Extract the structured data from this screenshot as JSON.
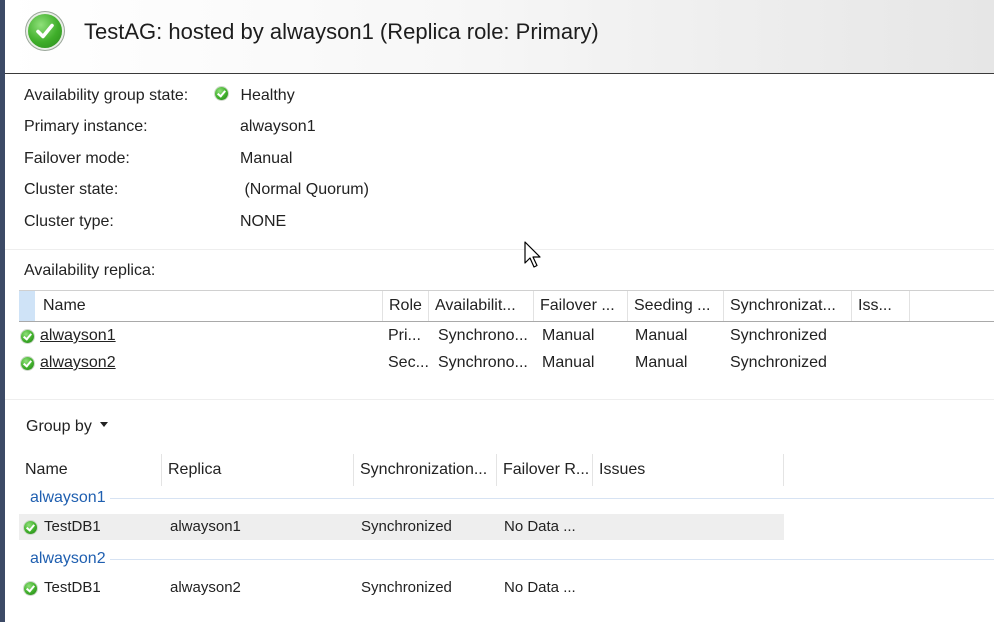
{
  "header": {
    "title": "TestAG: hosted by alwayson1 (Replica role: Primary)",
    "icon": "healthy-check-icon"
  },
  "properties": [
    {
      "label": "Availability group state:",
      "value": "Healthy",
      "icon": "healthy-check-icon"
    },
    {
      "label": "Primary instance:",
      "value": "alwayson1"
    },
    {
      "label": "Failover mode:",
      "value": "Manual"
    },
    {
      "label": "Cluster state:",
      "value": " (Normal Quorum)"
    },
    {
      "label": "Cluster type:",
      "value": "NONE"
    }
  ],
  "replicas": {
    "label": "Availability replica:",
    "columns": [
      "Name",
      "Role",
      "Availabilit...",
      "Failover ...",
      "Seeding ...",
      "Synchronizat...",
      "Iss..."
    ],
    "rows": [
      {
        "name": "alwayson1",
        "role": "Pri...",
        "availability": "Synchrono...",
        "failover": "Manual",
        "seeding": "Manual",
        "sync": "Synchronized",
        "issues": ""
      },
      {
        "name": "alwayson2",
        "role": "Sec...",
        "availability": "Synchrono...",
        "failover": "Manual",
        "seeding": "Manual",
        "sync": "Synchronized",
        "issues": ""
      }
    ]
  },
  "databases": {
    "group_by_label": "Group by",
    "columns": [
      "Name",
      "Replica",
      "Synchronization...",
      "Failover R...",
      "Issues"
    ],
    "groups": [
      {
        "name": "alwayson1",
        "rows": [
          {
            "name": "TestDB1",
            "replica": "alwayson1",
            "sync": "Synchronized",
            "failover": "No Data ...",
            "issues": ""
          }
        ]
      },
      {
        "name": "alwayson2",
        "rows": [
          {
            "name": "TestDB1",
            "replica": "alwayson2",
            "sync": "Synchronized",
            "failover": "No Data ...",
            "issues": ""
          }
        ]
      }
    ]
  },
  "colors": {
    "accent_link": "#0645ad",
    "group_header": "#1f5fb0",
    "healthy": "#3fae2a",
    "selection": "#cfe3f7"
  }
}
